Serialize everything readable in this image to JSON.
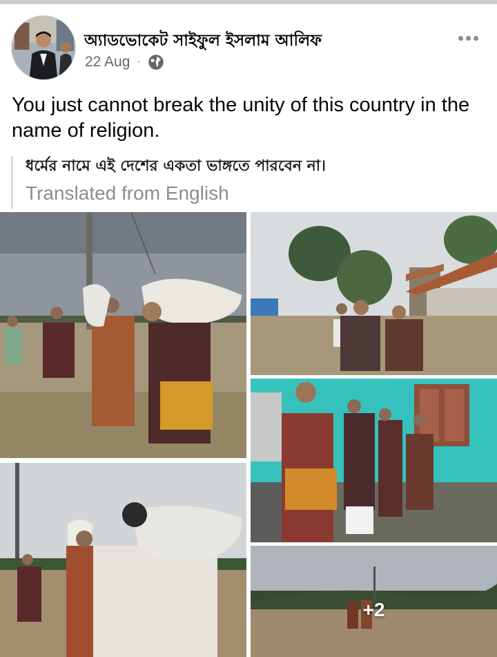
{
  "post": {
    "author": "অ্যাডভোকেট সাইফুল ইসলাম আলিফ",
    "date": "22 Aug",
    "separator": "·",
    "privacy_icon": "globe-icon",
    "text": "You just cannot break the unity of this country in the name of religion.",
    "translated_text": "ধর্মের নামে এই দেশের একতা ভাঙ্গতে পারবেন না।",
    "translation_note": "Translated from English"
  },
  "menu": {
    "icon": "more-options-icon"
  },
  "photos": {
    "count_overlay": "+2"
  },
  "colors": {
    "primary_text": "#050505",
    "secondary_text": "#65676b",
    "muted_text": "#8a8d91",
    "divider": "#d8dadf"
  }
}
